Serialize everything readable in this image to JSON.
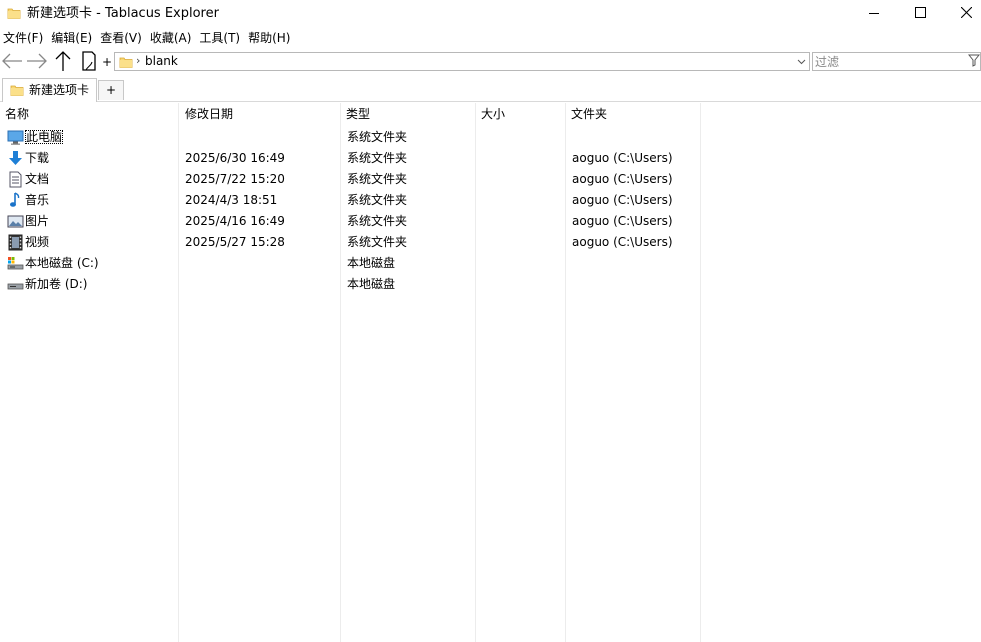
{
  "window": {
    "title": "新建选项卡 - Tablacus Explorer",
    "minimize_icon": "minimize-icon",
    "maximize_icon": "maximize-icon",
    "close_icon": "close-icon"
  },
  "menu": {
    "items": [
      {
        "label": "文件(F)"
      },
      {
        "label": "编辑(E)"
      },
      {
        "label": "查看(V)"
      },
      {
        "label": "收藏(A)"
      },
      {
        "label": "工具(T)"
      },
      {
        "label": "帮助(H)"
      }
    ]
  },
  "toolbar": {
    "back_icon": "back-arrow-icon",
    "forward_icon": "forward-arrow-icon",
    "up_icon": "up-arrow-icon",
    "new_tab_icon": "new-tab-icon",
    "plus_label": "+",
    "address": {
      "value": "blank",
      "separator": "›"
    },
    "filter": {
      "placeholder": "过滤",
      "icon": "funnel-icon"
    }
  },
  "tabs": {
    "items": [
      {
        "label": "新建选项卡"
      }
    ],
    "add_label": "+"
  },
  "columns": {
    "name": "名称",
    "date": "修改日期",
    "type": "类型",
    "size": "大小",
    "folder": "文件夹"
  },
  "rows": [
    {
      "name": "此电脑",
      "date": "",
      "type": "系统文件夹",
      "size": "",
      "folder": "",
      "icon": "computer-icon"
    },
    {
      "name": "下载",
      "date": "2025/6/30 16:49",
      "type": "系统文件夹",
      "size": "",
      "folder": "aoguo (C:\\Users)",
      "icon": "download-icon"
    },
    {
      "name": "文档",
      "date": "2025/7/22 15:20",
      "type": "系统文件夹",
      "size": "",
      "folder": "aoguo (C:\\Users)",
      "icon": "document-icon"
    },
    {
      "name": "音乐",
      "date": "2024/4/3 18:51",
      "type": "系统文件夹",
      "size": "",
      "folder": "aoguo (C:\\Users)",
      "icon": "music-icon"
    },
    {
      "name": "图片",
      "date": "2025/4/16 16:49",
      "type": "系统文件夹",
      "size": "",
      "folder": "aoguo (C:\\Users)",
      "icon": "picture-icon"
    },
    {
      "name": "视频",
      "date": "2025/5/27 15:28",
      "type": "系统文件夹",
      "size": "",
      "folder": "aoguo (C:\\Users)",
      "icon": "video-icon"
    },
    {
      "name": "本地磁盘 (C:)",
      "date": "",
      "type": "本地磁盘",
      "size": "",
      "folder": "",
      "icon": "system-drive-icon"
    },
    {
      "name": "新加卷 (D:)",
      "date": "",
      "type": "本地磁盘",
      "size": "",
      "folder": "",
      "icon": "drive-icon"
    }
  ],
  "colors": {
    "folder_yellow": "#f8d775",
    "download_blue": "#1e7fd6",
    "music_blue": "#1a73c9",
    "border": "#b8b8b8"
  }
}
